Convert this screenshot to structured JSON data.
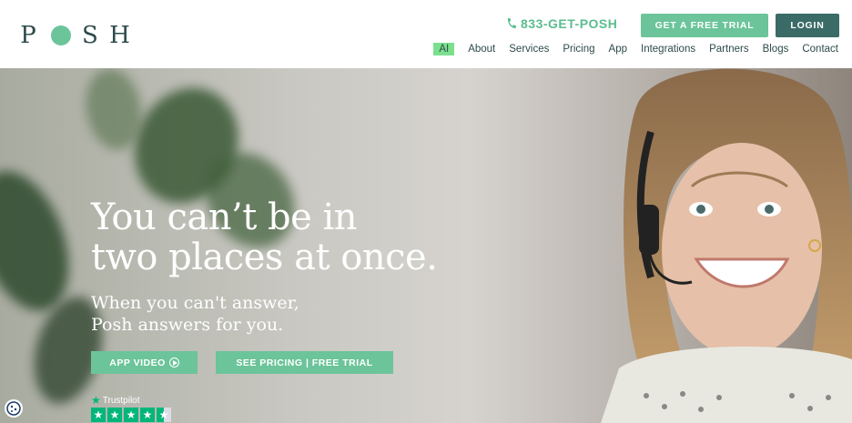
{
  "header": {
    "logo_left": "P",
    "logo_right": "S H",
    "phone": "833-GET-POSH",
    "trial_button": "GET A FREE TRIAL",
    "login_button": "LOGIN",
    "nav": [
      "AI",
      "About",
      "Services",
      "Pricing",
      "App",
      "Integrations",
      "Partners",
      "Blogs",
      "Contact"
    ]
  },
  "hero": {
    "headline_line1": "You can’t be in",
    "headline_line2": "two places at once.",
    "sub_line1": "When you can't answer,",
    "sub_line2": "Posh answers for you.",
    "app_video_button": "APP VIDEO",
    "pricing_button": "SEE PRICING | FREE TRIAL",
    "trustpilot_label": "Trustpilot"
  },
  "colors": {
    "accent": "#6cc49a",
    "dark": "#3a6b66",
    "ai_highlight": "#7be08e",
    "trustpilot": "#00b67a"
  },
  "icons": [
    "phone-icon",
    "play-icon",
    "trustpilot-star-icon",
    "cookie-icon"
  ]
}
